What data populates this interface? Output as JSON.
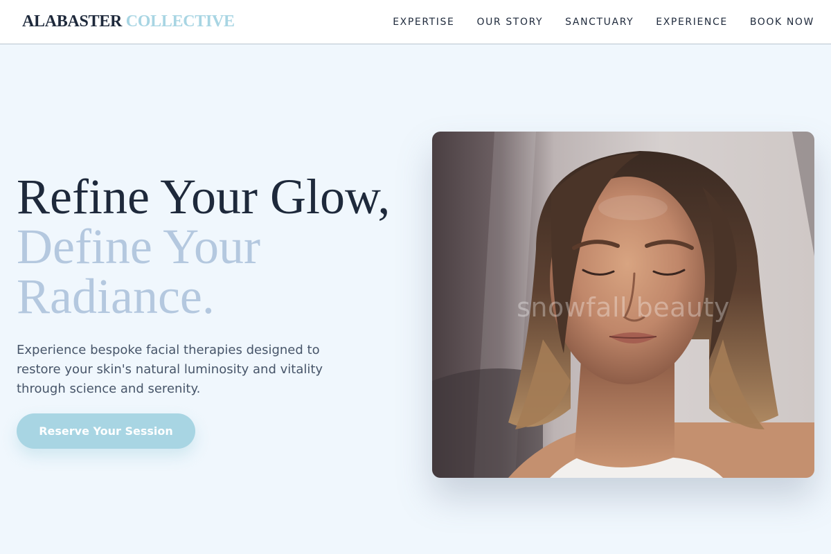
{
  "brand": {
    "part1": "ALABASTER",
    "part2": "COLLECTIVE"
  },
  "nav": {
    "items": [
      "EXPERTISE",
      "OUR STORY",
      "SANCTUARY",
      "EXPERIENCE",
      "BOOK NOW"
    ]
  },
  "hero": {
    "headline_line1": "Refine Your Glow,",
    "headline_line2": "Define Your Radiance.",
    "subtitle": "Experience bespoke facial therapies designed to restore your skin's natural luminosity and vitality through science and serenity.",
    "cta_label": "Reserve Your Session",
    "image_watermark": "snowfall beauty"
  },
  "colors": {
    "background": "#f0f7fd",
    "dark_text": "#1e293b",
    "accent": "#a8d5e3",
    "headline_muted": "#b4c8df",
    "body_text": "#475569"
  }
}
